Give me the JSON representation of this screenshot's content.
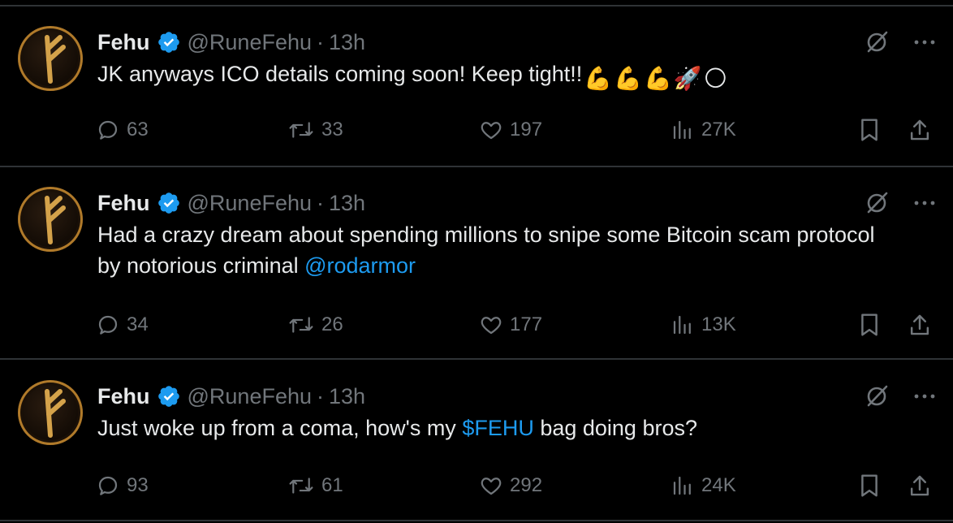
{
  "tweets": [
    {
      "name": "Fehu",
      "handle": "@RuneFehu",
      "time": "13h",
      "text": "JK anyways ICO details coming soon! Keep tight!!",
      "emojis": [
        "💪",
        "💪",
        "💪",
        "🚀",
        "🌕"
      ],
      "replies": "63",
      "retweets": "33",
      "likes": "197",
      "views": "27K"
    },
    {
      "name": "Fehu",
      "handle": "@RuneFehu",
      "time": "13h",
      "text": "Had a crazy dream about spending millions to snipe some Bitcoin scam protocol by notorious criminal ",
      "mention": "@rodarmor",
      "replies": "34",
      "retweets": "26",
      "likes": "177",
      "views": "13K"
    },
    {
      "name": "Fehu",
      "handle": "@RuneFehu",
      "time": "13h",
      "text_before": "Just woke up from a coma, how's my ",
      "cashtag": "$FEHU",
      "text_after": " bag doing bros?",
      "replies": "93",
      "retweets": "61",
      "likes": "292",
      "views": "24K"
    }
  ],
  "meta": {
    "dot": "·"
  },
  "icons": {
    "verified": "verified-badge-icon",
    "grok": "grok-icon",
    "more": "more-options-icon",
    "reply": "reply-icon",
    "retweet": "retweet-icon",
    "like": "like-icon",
    "views": "views-icon",
    "bookmark": "bookmark-icon",
    "share": "share-icon"
  },
  "colors": {
    "background": "#000000",
    "text": "#e7e9ea",
    "muted": "#71767b",
    "link": "#1d9bf0",
    "verified": "#1d9bf0",
    "avatar_rune": "#d4a24a"
  }
}
